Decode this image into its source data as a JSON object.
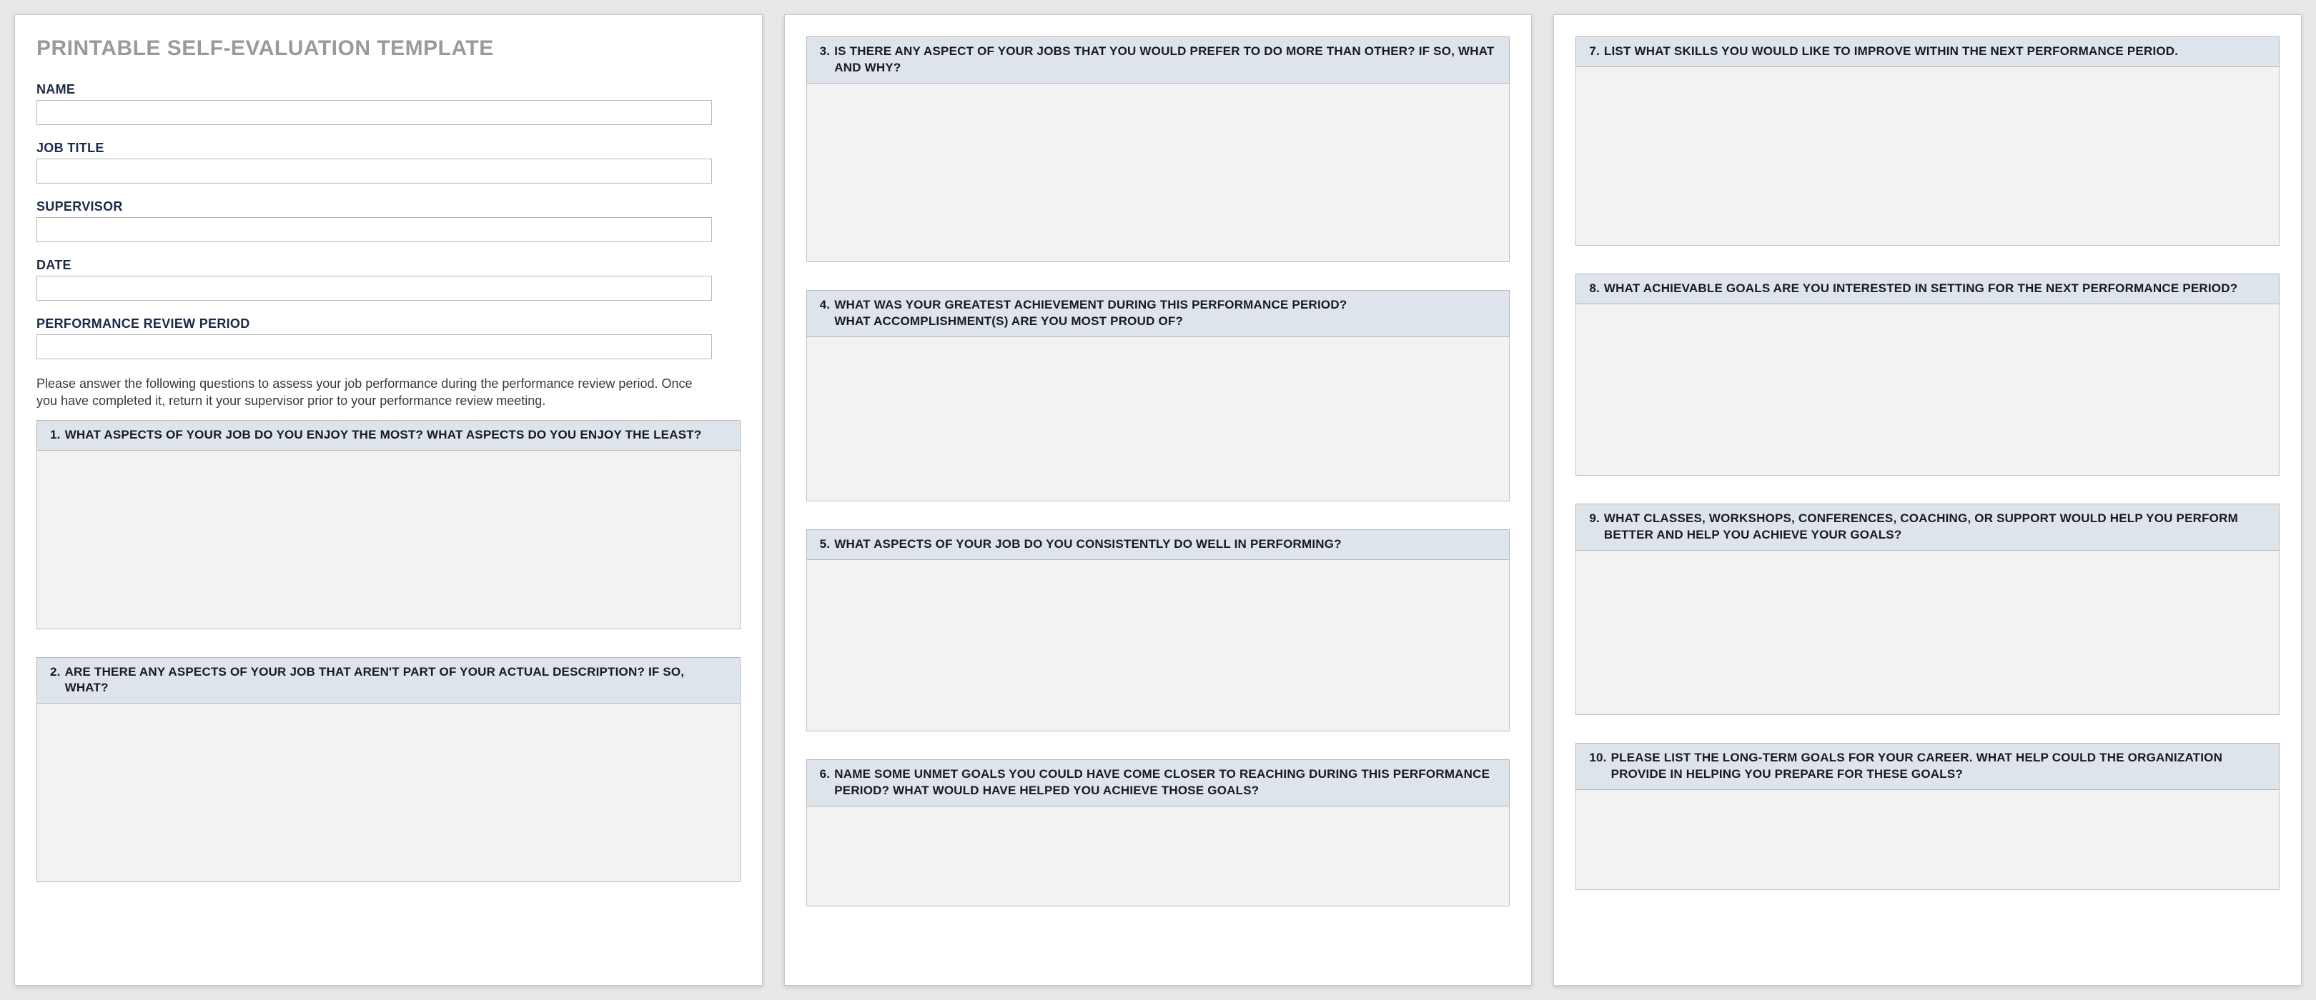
{
  "title": "PRINTABLE SELF-EVALUATION TEMPLATE",
  "fields": {
    "name": {
      "label": "NAME",
      "value": ""
    },
    "job_title": {
      "label": "JOB TITLE",
      "value": ""
    },
    "supervisor": {
      "label": "SUPERVISOR",
      "value": ""
    },
    "date": {
      "label": "DATE",
      "value": ""
    },
    "period": {
      "label": "PERFORMANCE REVIEW PERIOD",
      "value": ""
    }
  },
  "instructions": "Please answer the following questions to assess your job performance during the performance review period. Once you have completed it, return it your supervisor prior to your performance review meeting.",
  "questions": {
    "q1": {
      "num": "1.",
      "text": "WHAT ASPECTS OF YOUR JOB DO YOU ENJOY THE MOST? WHAT ASPECTS DO YOU ENJOY THE LEAST?",
      "answer": ""
    },
    "q2": {
      "num": "2.",
      "text": "ARE THERE ANY ASPECTS OF YOUR JOB THAT AREN'T PART OF YOUR ACTUAL DESCRIPTION? IF SO, WHAT?",
      "answer": ""
    },
    "q3": {
      "num": "3.",
      "text": "IS THERE ANY ASPECT OF YOUR JOBS THAT YOU WOULD PREFER TO DO MORE THAN OTHER? IF SO, WHAT AND WHY?",
      "answer": ""
    },
    "q4": {
      "num": "4.",
      "text": "WHAT WAS YOUR GREATEST ACHIEVEMENT DURING THIS PERFORMANCE PERIOD?\nWHAT ACCOMPLISHMENT(S) ARE YOU MOST PROUD OF?",
      "answer": ""
    },
    "q5": {
      "num": "5.",
      "text": "WHAT ASPECTS OF YOUR JOB DO YOU CONSISTENTLY DO WELL IN PERFORMING?",
      "answer": ""
    },
    "q6": {
      "num": "6.",
      "text": "NAME SOME UNMET GOALS YOU COULD HAVE COME CLOSER TO REACHING DURING THIS PERFORMANCE PERIOD? WHAT WOULD HAVE HELPED YOU ACHIEVE THOSE GOALS?",
      "answer": ""
    },
    "q7": {
      "num": "7.",
      "text": "LIST WHAT SKILLS YOU WOULD LIKE TO IMPROVE WITHIN THE NEXT PERFORMANCE PERIOD.",
      "answer": ""
    },
    "q8": {
      "num": "8.",
      "text": "WHAT ACHIEVABLE GOALS ARE YOU INTERESTED IN SETTING FOR THE NEXT PERFORMANCE PERIOD?",
      "answer": ""
    },
    "q9": {
      "num": "9.",
      "text": "WHAT CLASSES, WORKSHOPS, CONFERENCES, COACHING, OR SUPPORT WOULD HELP YOU PERFORM BETTER AND HELP YOU ACHIEVE YOUR GOALS?",
      "answer": ""
    },
    "q10": {
      "num": "10.",
      "text": "PLEASE LIST THE LONG-TERM GOALS FOR YOUR CAREER. WHAT HELP COULD THE ORGANIZATION PROVIDE IN HELPING YOU PREPARE FOR THESE GOALS?",
      "answer": ""
    }
  }
}
